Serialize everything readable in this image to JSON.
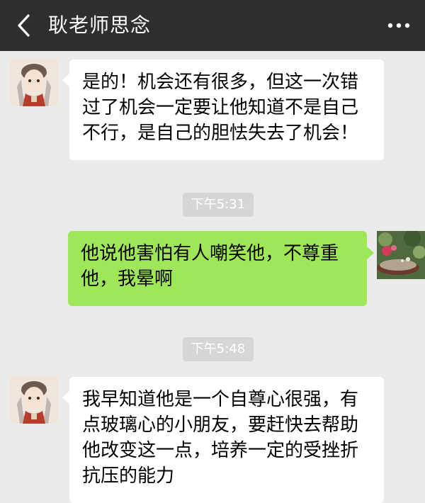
{
  "header": {
    "title": "耿老师思念",
    "back_icon": "chevron-left-icon",
    "more_icon": "more-dots-icon"
  },
  "messages": [
    {
      "side": "left",
      "text": "是的！机会还有很多，但这一次错过了机会一定要让他知道不是自己不行，是自己的胆怯失去了机会！"
    },
    {
      "type": "time",
      "text": "下午5:31"
    },
    {
      "side": "right",
      "text": "他说他害怕有人嘲笑他，不尊重他，我晕啊"
    },
    {
      "type": "time",
      "text": "下午5:48"
    },
    {
      "side": "left",
      "text": "我早知道他是一个自尊心很强，有点玻璃心的小朋友，要赶快去帮助他改变这一点，培养一定的受挫折抗压的能力"
    }
  ],
  "colors": {
    "header_bg": "#2e2e2e",
    "chat_bg": "#ebebeb",
    "sent_bubble": "#9fe658",
    "received_bubble": "#ffffff",
    "timestamp_bg": "#d6d6d6"
  }
}
